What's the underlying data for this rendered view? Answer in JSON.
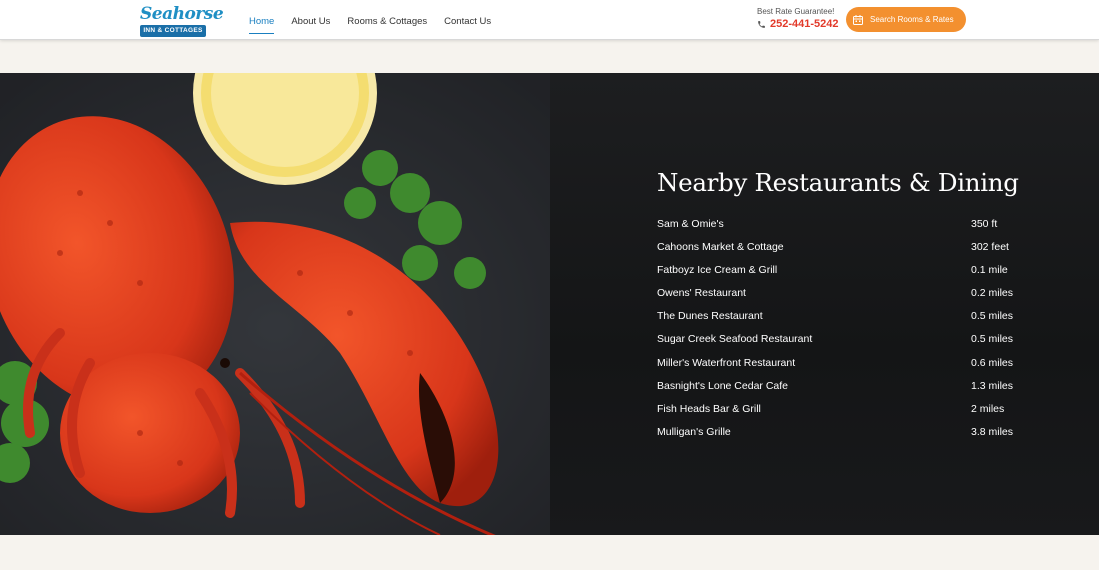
{
  "header": {
    "logo": {
      "script": "Seahorse",
      "banner": "INN & COTTAGES"
    },
    "nav": [
      {
        "label": "Home",
        "active": true
      },
      {
        "label": "About Us",
        "active": false
      },
      {
        "label": "Rooms & Cottages",
        "active": false
      },
      {
        "label": "Contact Us",
        "active": false
      }
    ],
    "rate_label": "Best Rate Guarantee!",
    "phone": "252-441-5242",
    "search_button": "Search Rooms & Rates"
  },
  "dining": {
    "title": "Nearby Restaurants & Dining",
    "restaurants": [
      {
        "name": "Sam & Omie's",
        "distance": "350 ft"
      },
      {
        "name": "Cahoons Market & Cottage",
        "distance": "302 feet"
      },
      {
        "name": "Fatboyz Ice Cream & Grill",
        "distance": "0.1 mile"
      },
      {
        "name": "Owens' Restaurant",
        "distance": "0.2 miles"
      },
      {
        "name": "The Dunes Restaurant",
        "distance": "0.5 miles"
      },
      {
        "name": "Sugar Creek Seafood Restaurant",
        "distance": "0.5 miles"
      },
      {
        "name": "Miller's Waterfront Restaurant",
        "distance": "0.6 miles"
      },
      {
        "name": "Basnight's Lone Cedar Cafe",
        "distance": "1.3 miles"
      },
      {
        "name": "Fish Heads Bar & Grill",
        "distance": "2 miles"
      },
      {
        "name": "Mulligan's Grille",
        "distance": "3.8 miles"
      }
    ]
  },
  "colors": {
    "accent_blue": "#1a7fc0",
    "phone_red": "#e23a2a",
    "button_orange": "#f3902f",
    "panel_dark": "#141516",
    "page_bg": "#f6f3ee"
  },
  "icons": [
    "phone-icon",
    "calendar-icon"
  ]
}
